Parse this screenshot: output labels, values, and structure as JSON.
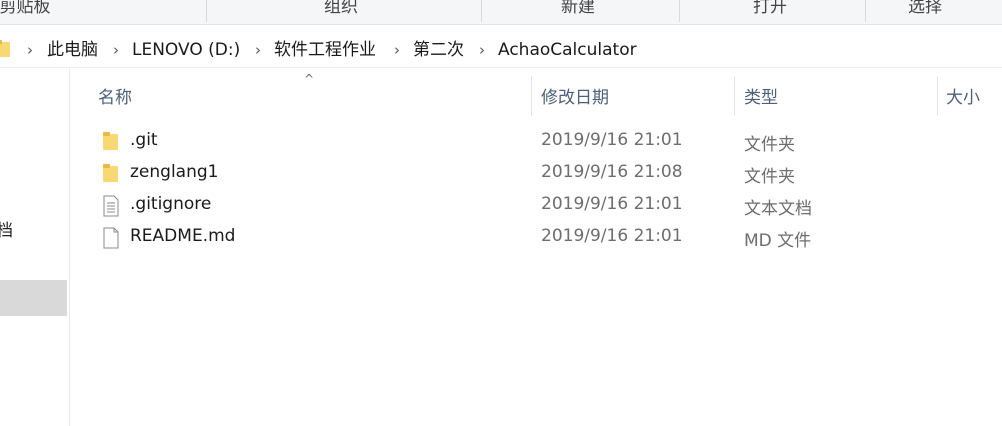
{
  "ribbon": {
    "groups": [
      {
        "label": "剪贴板"
      },
      {
        "label": "组织"
      },
      {
        "label": "新建"
      },
      {
        "label": "打开"
      },
      {
        "label": "选择"
      }
    ]
  },
  "address": {
    "crumbs": [
      "此电脑",
      "LENOVO (D:)",
      "软件工程作业",
      "第二次",
      "AchaoCalculator"
    ]
  },
  "nav": {
    "partial_label": "档"
  },
  "columns": {
    "name": "名称",
    "date": "修改日期",
    "type": "类型",
    "size": "大小"
  },
  "files": [
    {
      "name": ".git",
      "date": "2019/9/16 21:01",
      "type": "文件夹",
      "icon": "folder-icon"
    },
    {
      "name": "zenglang1",
      "date": "2019/9/16 21:08",
      "type": "文件夹",
      "icon": "folder-icon"
    },
    {
      "name": ".gitignore",
      "date": "2019/9/16 21:01",
      "type": "文本文档",
      "icon": "text-file-icon"
    },
    {
      "name": "README.md",
      "date": "2019/9/16 21:01",
      "type": "MD 文件",
      "icon": "file-icon"
    }
  ],
  "colors": {
    "header_text": "#4c607a",
    "folder_yellow": "#f8d775",
    "selection_gray": "#d9d9d9"
  }
}
